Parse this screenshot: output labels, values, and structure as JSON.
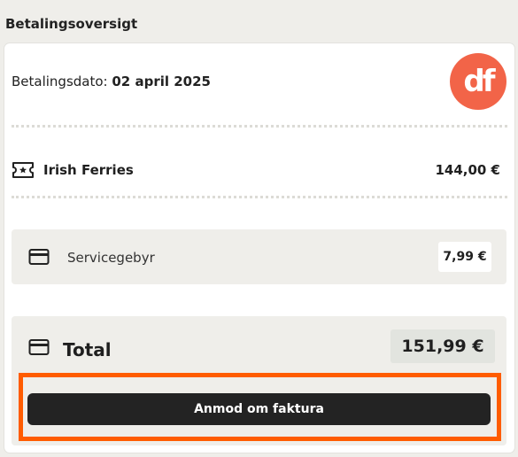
{
  "section": {
    "title": "Betalingsoversigt"
  },
  "payment": {
    "date_label": "Betalingsdato: ",
    "date_value": "02 april 2025",
    "logo_text": "df",
    "logo_color": "#f26448"
  },
  "ferry": {
    "icon": "ticket-icon",
    "name": "Irish Ferries",
    "price": "144,00 €"
  },
  "fee": {
    "icon": "card-icon",
    "label": "Servicegebyr",
    "price": "7,99 €"
  },
  "total": {
    "icon": "card-icon",
    "label": "Total",
    "price": "151,99 €"
  },
  "actions": {
    "invoice_label": "Anmod om faktura",
    "highlight_color": "#ff5c00"
  }
}
